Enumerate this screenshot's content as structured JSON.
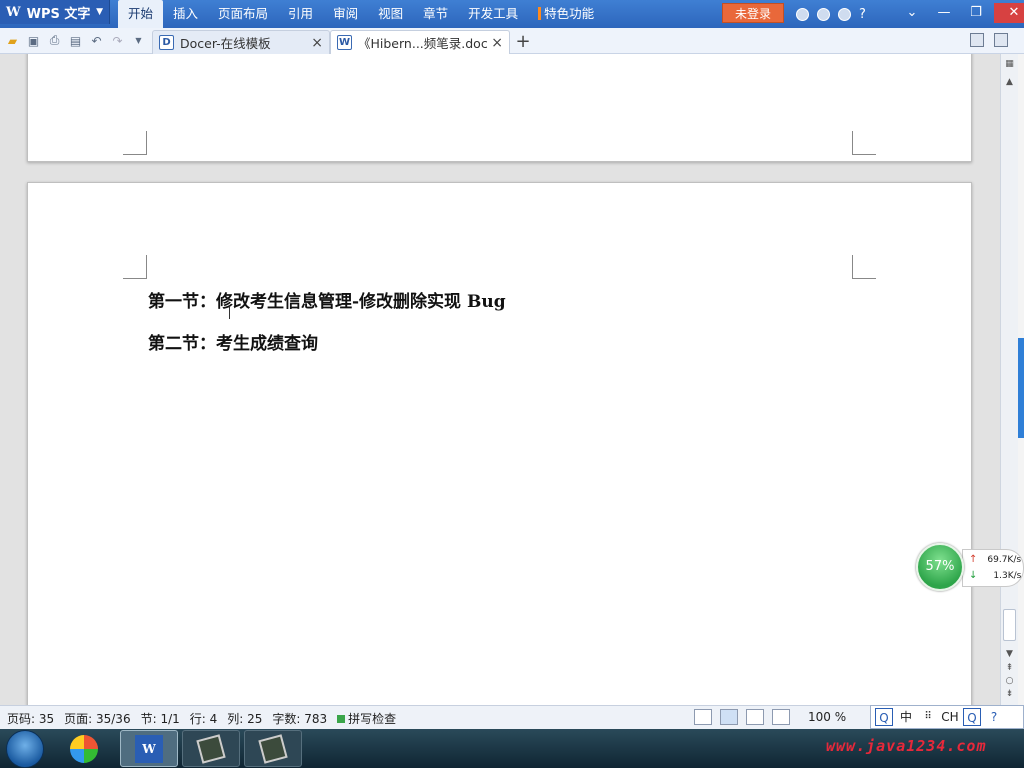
{
  "app": {
    "name": "WPS 文字"
  },
  "menu": {
    "items": [
      "开始",
      "插入",
      "页面布局",
      "引用",
      "审阅",
      "视图",
      "章节",
      "开发工具",
      "特色功能"
    ],
    "active_index": 0
  },
  "header": {
    "login_label": "未登录",
    "help_label": "?"
  },
  "tabs": [
    {
      "label": "Docer-在线模板",
      "icon": "docer-icon",
      "close": "×"
    },
    {
      "label": "《Hibern...频笔录.doc",
      "icon": "word-doc-icon",
      "close": "×"
    }
  ],
  "new_tab_label": "+",
  "document": {
    "headings": [
      "第一节：修改考生信息管理-修改删除实现 Bug",
      "第二节：考生成绩查询"
    ]
  },
  "network_monitor": {
    "cpu_percent": "57%",
    "upload": "69.7K/s",
    "download": "1.3K/s"
  },
  "status": {
    "page_code": "页码: 35",
    "page": "页面: 35/36",
    "section": "节: 1/1",
    "row": "行: 4",
    "col": "列: 25",
    "word_count": "字数: 783",
    "spell_check": "拼写检查",
    "zoom": "100 %"
  },
  "ime": {
    "q": "Q",
    "mode": "中",
    "lang": "CH"
  },
  "watermark": "www.java1234.com",
  "colors": {
    "title_blue": "#3f7fd3",
    "login_orange": "#e9683a",
    "cpu_green": "#2ea54a",
    "watermark_red": "#e8283a"
  }
}
